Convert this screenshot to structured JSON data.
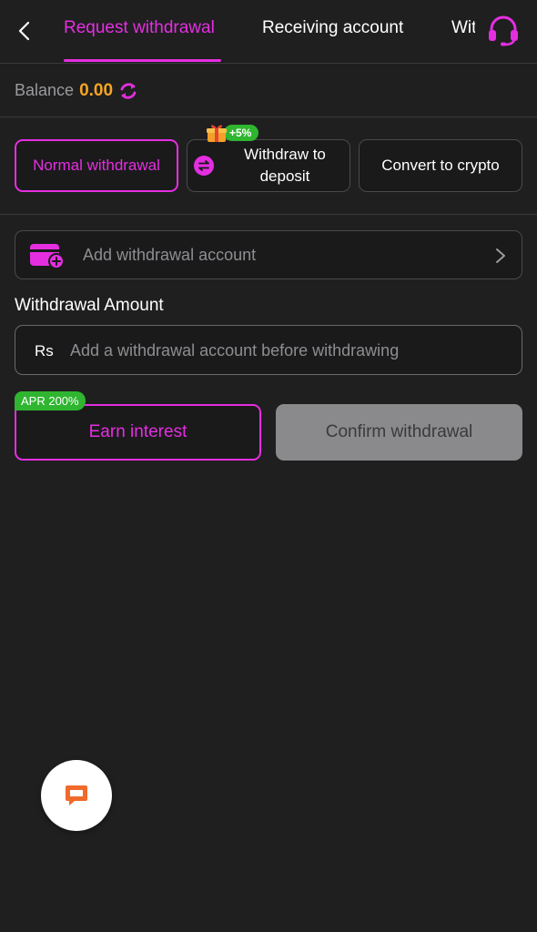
{
  "header": {
    "tabs": [
      {
        "label": "Request withdrawal",
        "active": true
      },
      {
        "label": "Receiving account",
        "active": false
      },
      {
        "label": "Withdrawal history",
        "active": false
      }
    ]
  },
  "balance": {
    "label": "Balance",
    "value": "0.00"
  },
  "modes": {
    "normal_label": "Normal withdrawal",
    "deposit_label_line1": "Withdraw to",
    "deposit_label_line2": "deposit",
    "deposit_bonus": "+5%",
    "crypto_label": "Convert to crypto"
  },
  "account": {
    "add_label": "Add withdrawal account"
  },
  "amount": {
    "section_label": "Withdrawal Amount",
    "currency": "Rs",
    "placeholder": "Add a withdrawal account before withdrawing"
  },
  "actions": {
    "apr_badge": "APR 200%",
    "earn_label": "Earn interest",
    "confirm_label": "Confirm withdrawal"
  },
  "colors": {
    "accent": "#e52ee0",
    "balance": "#f5a623",
    "badge_green": "#2fb52f",
    "background": "#1f1f20",
    "chat_icon": "#f06a2a"
  },
  "icons": {
    "back": "chevron-left-icon",
    "support": "headset-icon",
    "refresh": "refresh-icon",
    "gift": "gift-icon",
    "swap": "swap-icon",
    "wallet": "wallet-add-icon",
    "chevron": "chevron-right-icon",
    "chat": "chat-bubble-icon"
  }
}
